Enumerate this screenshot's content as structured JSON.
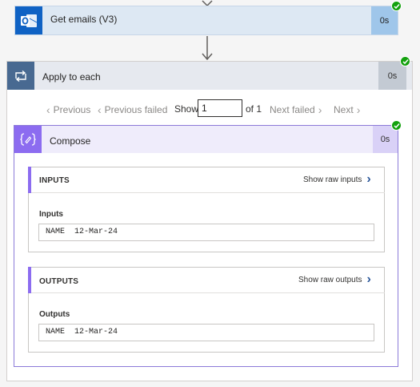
{
  "get_emails": {
    "title": "Get emails (V3)",
    "duration": "0s",
    "icon": "outlook-icon",
    "status": "succeeded"
  },
  "apply_to_each": {
    "title": "Apply to each",
    "duration": "0s",
    "icon": "loop-icon",
    "status": "succeeded"
  },
  "pager": {
    "previous": "Previous",
    "previous_failed": "Previous failed",
    "show_label": "Show",
    "current": "1",
    "of_label": "of 1",
    "next_failed": "Next failed",
    "next": "Next"
  },
  "compose": {
    "title": "Compose",
    "duration": "0s",
    "icon": "compose-icon",
    "status": "succeeded",
    "inputs": {
      "header": "INPUTS",
      "raw_link": "Show raw inputs",
      "field_label": "Inputs",
      "value": "NAME  12-Mar-24"
    },
    "outputs": {
      "header": "OUTPUTS",
      "raw_link": "Show raw outputs",
      "field_label": "Outputs",
      "value": "NAME  12-Mar-24"
    }
  },
  "colors": {
    "success": "#13a10e",
    "outlook_blue": "#0f62c4",
    "loop_blue": "#486991",
    "compose_purple": "#8c6cf0"
  }
}
